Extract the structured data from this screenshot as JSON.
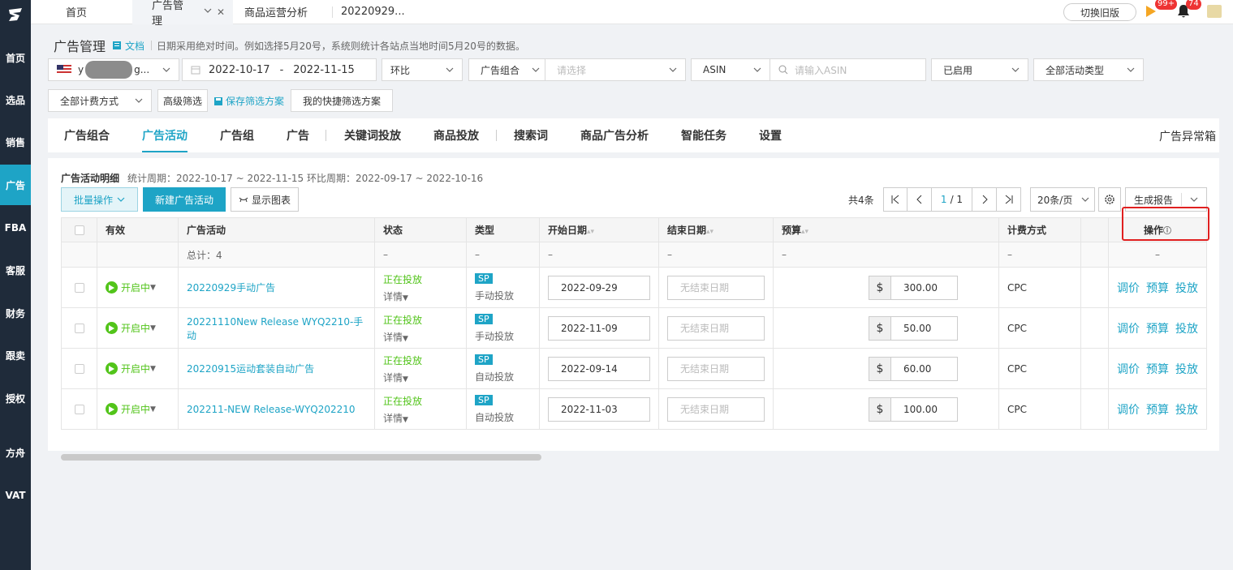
{
  "sidebar": {
    "items": [
      {
        "label": "首页"
      },
      {
        "label": "选品"
      },
      {
        "label": "销售"
      },
      {
        "label": "广告"
      },
      {
        "label": "FBA"
      },
      {
        "label": "客服"
      },
      {
        "label": "财务"
      },
      {
        "label": "跟卖"
      },
      {
        "label": "授权"
      },
      {
        "label": "方舟"
      },
      {
        "label": "VAT"
      }
    ]
  },
  "topbar": {
    "tabs": [
      {
        "label": "首页"
      },
      {
        "label": "广告管理"
      },
      {
        "label": "商品运营分析"
      },
      {
        "label": "20220929..."
      }
    ],
    "switch_old": "切换旧版",
    "badge_flag": "99+",
    "badge_bell": "74"
  },
  "header": {
    "title": "广告管理",
    "doc": "文档",
    "note": "日期采用绝对时间。例如选择5月20号，系统则统计各站点当地时间5月20号的数据。"
  },
  "filters": {
    "store_value": "y",
    "store_suffix": "g...",
    "date_start": "2022-10-17",
    "date_sep": "-",
    "date_end": "2022-11-15",
    "compare": "环比",
    "group_label": "广告组合",
    "group_placeholder": "请选择",
    "asin_type": "ASIN",
    "asin_placeholder": "请输入ASIN",
    "enabled": "已启用",
    "campaign_type": "全部活动类型",
    "billing": "全部计费方式",
    "advanced": "高级筛选",
    "save_plan": "保存筛选方案",
    "my_plans": "我的快捷筛选方案"
  },
  "panel_tabs": [
    {
      "label": "广告组合"
    },
    {
      "label": "广告活动"
    },
    {
      "label": "广告组"
    },
    {
      "label": "广告"
    },
    {
      "label": "关键词投放"
    },
    {
      "label": "商品投放"
    },
    {
      "label": "搜索词"
    },
    {
      "label": "商品广告分析"
    },
    {
      "label": "智能任务"
    },
    {
      "label": "设置"
    }
  ],
  "anomaly_box": "广告异常箱",
  "card": {
    "title": "广告活动明细",
    "period": "统计周期：2022-10-17 ~ 2022-11-15 环比周期：2022-09-17 ~ 2022-10-16",
    "bulk": "批量操作",
    "new_campaign": "新建广告活动",
    "show_chart": "显示图表",
    "total_count": "共4条",
    "page_current": "1",
    "page_total": "/ 1",
    "page_size": "20条/页",
    "generate_report": "生成报告"
  },
  "table": {
    "headers": {
      "valid": "有效",
      "campaign": "广告活动",
      "status": "状态",
      "type": "类型",
      "start": "开始日期",
      "end": "结束日期",
      "budget": "预算",
      "billing": "计费方式",
      "ops": "操作"
    },
    "total": {
      "label": "总计：4",
      "dash": "–"
    },
    "rows": [
      {
        "valid": "开启中",
        "name": "20220929手动广告",
        "status": "正在投放",
        "detail": "详情",
        "sp": "SP",
        "type": "手动投放",
        "start": "2022-09-29",
        "end": "无结束日期",
        "currency": "$",
        "budget": "300.00",
        "billing": "CPC",
        "op1": "调价",
        "op2": "预算",
        "op3": "投放"
      },
      {
        "valid": "开启中",
        "name": "20221110New Release WYQ2210-手动",
        "status": "正在投放",
        "detail": "详情",
        "sp": "SP",
        "type": "手动投放",
        "start": "2022-11-09",
        "end": "无结束日期",
        "currency": "$",
        "budget": "50.00",
        "billing": "CPC",
        "op1": "调价",
        "op2": "预算",
        "op3": "投放"
      },
      {
        "valid": "开启中",
        "name": "20220915运动套装自动广告",
        "status": "正在投放",
        "detail": "详情",
        "sp": "SP",
        "type": "自动投放",
        "start": "2022-09-14",
        "end": "无结束日期",
        "currency": "$",
        "budget": "60.00",
        "billing": "CPC",
        "op1": "调价",
        "op2": "预算",
        "op3": "投放"
      },
      {
        "valid": "开启中",
        "name": "202211-NEW Release-WYQ202210",
        "status": "正在投放",
        "detail": "详情",
        "sp": "SP",
        "type": "自动投放",
        "start": "2022-11-03",
        "end": "无结束日期",
        "currency": "$",
        "budget": "100.00",
        "billing": "CPC",
        "op1": "调价",
        "op2": "预算",
        "op3": "投放"
      }
    ]
  },
  "colors": {
    "accent": "#1ea4c6",
    "sidebar": "#1f2b3a",
    "success": "#52c41a",
    "highlight": "#e02020"
  }
}
